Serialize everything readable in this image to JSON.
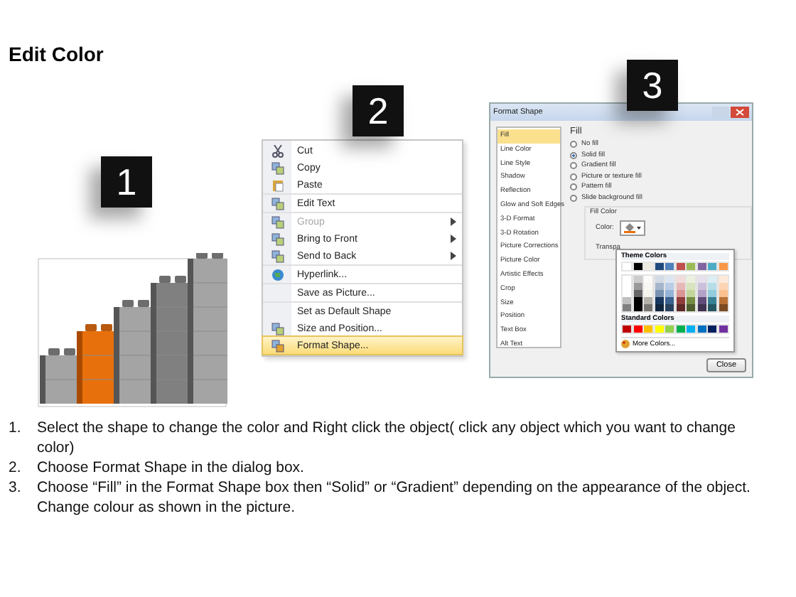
{
  "title": "Edit Color",
  "badges": [
    "1",
    "2",
    "3"
  ],
  "menu": {
    "sections": [
      [
        {
          "label": "Cut",
          "disabled": false,
          "submenu": false,
          "selected": false
        },
        {
          "label": "Copy",
          "disabled": false,
          "submenu": false,
          "selected": false
        },
        {
          "label": "Paste",
          "disabled": false,
          "submenu": false,
          "selected": false
        }
      ],
      [
        {
          "label": "Edit Text",
          "disabled": false,
          "submenu": false,
          "selected": false
        }
      ],
      [
        {
          "label": "Group",
          "disabled": true,
          "submenu": true,
          "selected": false
        },
        {
          "label": "Bring to Front",
          "disabled": false,
          "submenu": true,
          "selected": false
        },
        {
          "label": "Send to Back",
          "disabled": false,
          "submenu": true,
          "selected": false
        }
      ],
      [
        {
          "label": "Hyperlink...",
          "disabled": false,
          "submenu": false,
          "selected": false
        }
      ],
      [
        {
          "label": "Save as Picture...",
          "disabled": false,
          "submenu": false,
          "selected": false
        }
      ],
      [
        {
          "label": "Set as Default Shape",
          "disabled": false,
          "submenu": false,
          "selected": false
        },
        {
          "label": "Size and Position...",
          "disabled": false,
          "submenu": false,
          "selected": false
        },
        {
          "label": "Format Shape...",
          "disabled": false,
          "submenu": false,
          "selected": true
        }
      ]
    ]
  },
  "dialog": {
    "title": "Format Shape",
    "sidebar": [
      {
        "label": "Fill",
        "selected": true
      },
      {
        "label": "Line Color",
        "selected": false
      },
      {
        "label": "Line Style",
        "selected": false
      },
      {
        "label": "Shadow",
        "selected": false
      },
      {
        "label": "Reflection",
        "selected": false
      },
      {
        "label": "Glow and Soft Edges",
        "selected": false
      },
      {
        "label": "3-D Format",
        "selected": false
      },
      {
        "label": "3-D Rotation",
        "selected": false
      },
      {
        "label": "Picture Corrections",
        "selected": false
      },
      {
        "label": "Picture Color",
        "selected": false
      },
      {
        "label": "Artistic Effects",
        "selected": false
      },
      {
        "label": "Crop",
        "selected": false
      },
      {
        "label": "Size",
        "selected": false
      },
      {
        "label": "Position",
        "selected": false
      },
      {
        "label": "Text Box",
        "selected": false
      },
      {
        "label": "Alt Text",
        "selected": false
      }
    ],
    "heading": "Fill",
    "options": [
      {
        "label": "No fill",
        "selected": false
      },
      {
        "label": "Solid fill",
        "selected": true
      },
      {
        "label": "Gradient fill",
        "selected": false
      },
      {
        "label": "Picture or texture fill",
        "selected": false
      },
      {
        "label": "Pattern fill",
        "selected": false
      },
      {
        "label": "Slide background fill",
        "selected": false
      }
    ],
    "group_label": "Fill Color",
    "color_label": "Color:",
    "transparency_label": "Transpa",
    "palette": {
      "theme_title": "Theme Colors",
      "theme_colors": [
        {
          "color": "#ffffff"
        },
        {
          "color": "#000000"
        },
        {
          "color": "#eeece1"
        },
        {
          "color": "#1f497d"
        },
        {
          "color": "#4f81bd"
        },
        {
          "color": "#c0504d"
        },
        {
          "color": "#9bbb59"
        },
        {
          "color": "#8064a2"
        },
        {
          "color": "#4bacc6"
        },
        {
          "color": "#f79646"
        }
      ],
      "standard_title": "Standard Colors",
      "standard_colors": [
        {
          "color": "#c00000"
        },
        {
          "color": "#ff0000"
        },
        {
          "color": "#ffc000"
        },
        {
          "color": "#ffff00"
        },
        {
          "color": "#92d050"
        },
        {
          "color": "#00b050"
        },
        {
          "color": "#00b0f0"
        },
        {
          "color": "#0070c0"
        },
        {
          "color": "#002060"
        },
        {
          "color": "#7030a0"
        }
      ],
      "more": "More Colors..."
    },
    "close": "Close"
  },
  "steps": [
    {
      "number": "1.",
      "text": "Select the shape to change the color and Right click the object( click any object which you want to change color)"
    },
    {
      "number": "2.",
      "text": "Choose Format Shape in the dialog box."
    },
    {
      "number": "3.",
      "text": "Choose “Fill” in the Format Shape box then “Solid” or “Gradient” depending on the appearance of the object. Change colour as shown in the picture."
    }
  ]
}
